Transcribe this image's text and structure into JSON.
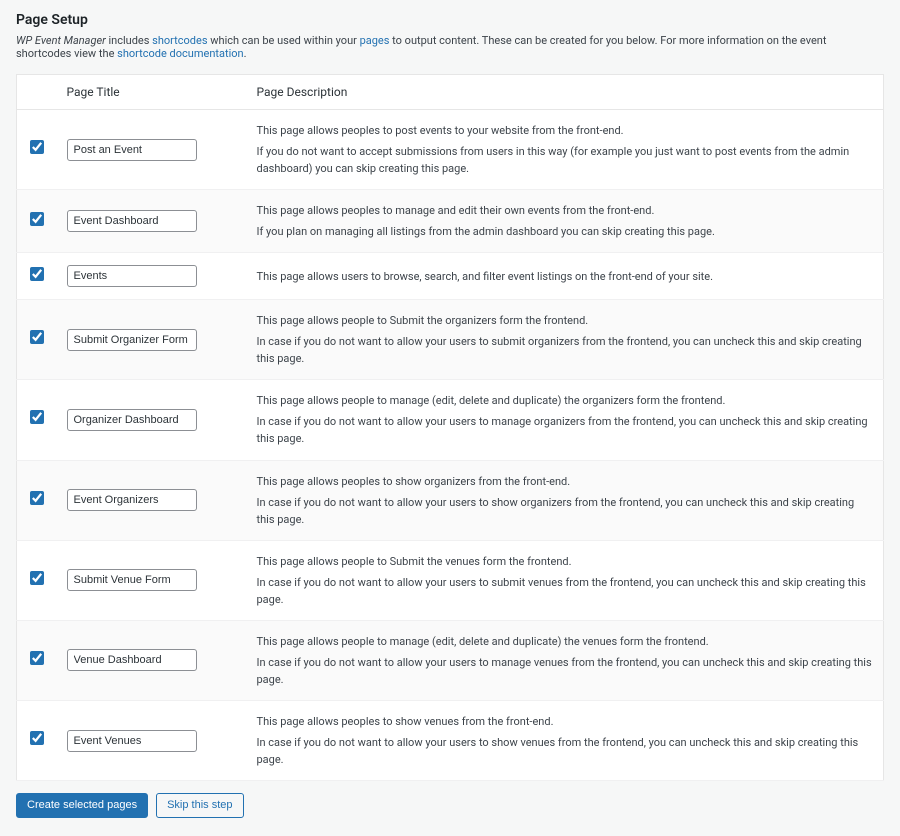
{
  "header": {
    "title": "Page Setup",
    "intro_prefix_em": "WP Event Manager",
    "intro_text_1": " includes ",
    "intro_link_1": "shortcodes",
    "intro_text_2": " which can be used within your ",
    "intro_link_2": "pages",
    "intro_text_3": " to output content. These can be created for you below. For more information on the event shortcodes view the ",
    "intro_link_3": "shortcode documentation",
    "intro_period": "."
  },
  "table": {
    "col_title": "Page Title",
    "col_desc": "Page Description",
    "rows": [
      {
        "checked": true,
        "title_value": "Post an Event",
        "desc1": "This page allows peoples to post events to your website from the front-end.",
        "desc2": "If you do not want to accept submissions from users in this way (for example you just want to post events from the admin dashboard) you can skip creating this page."
      },
      {
        "checked": true,
        "title_value": "Event Dashboard",
        "desc1": "This page allows peoples to manage and edit their own events from the front-end.",
        "desc2": "If you plan on managing all listings from the admin dashboard you can skip creating this page."
      },
      {
        "checked": true,
        "title_value": "Events",
        "desc1": "This page allows users to browse, search, and filter event listings on the front-end of your site.",
        "desc2": ""
      },
      {
        "checked": true,
        "title_value": "Submit Organizer Form",
        "desc1": "This page allows people to Submit the organizers form the frontend.",
        "desc2": "In case if you do not want to allow your users to submit organizers from the frontend, you can uncheck this and skip creating this page."
      },
      {
        "checked": true,
        "title_value": "Organizer Dashboard",
        "desc1": "This page allows people to manage (edit, delete and duplicate) the organizers form the frontend.",
        "desc2": "In case if you do not want to allow your users to manage organizers from the frontend, you can uncheck this and skip creating this page."
      },
      {
        "checked": true,
        "title_value": "Event Organizers",
        "desc1": "This page allows peoples to show organizers from the front-end.",
        "desc2": "In case if you do not want to allow your users to show organizers from the frontend, you can uncheck this and skip creating this page."
      },
      {
        "checked": true,
        "title_value": "Submit Venue Form",
        "desc1": "This page allows people to Submit the venues form the frontend.",
        "desc2": "In case if you do not want to allow your users to submit venues from the frontend, you can uncheck this and skip creating this page."
      },
      {
        "checked": true,
        "title_value": "Venue Dashboard",
        "desc1": "This page allows people to manage (edit, delete and duplicate) the venues form the frontend.",
        "desc2": "In case if you do not want to allow your users to manage venues from the frontend, you can uncheck this and skip creating this page."
      },
      {
        "checked": true,
        "title_value": "Event Venues",
        "desc1": "This page allows peoples to show venues from the front-end.",
        "desc2": "In case if you do not want to allow your users to show venues from the frontend, you can uncheck this and skip creating this page."
      }
    ]
  },
  "actions": {
    "primary": "Create selected pages",
    "secondary": "Skip this step"
  }
}
